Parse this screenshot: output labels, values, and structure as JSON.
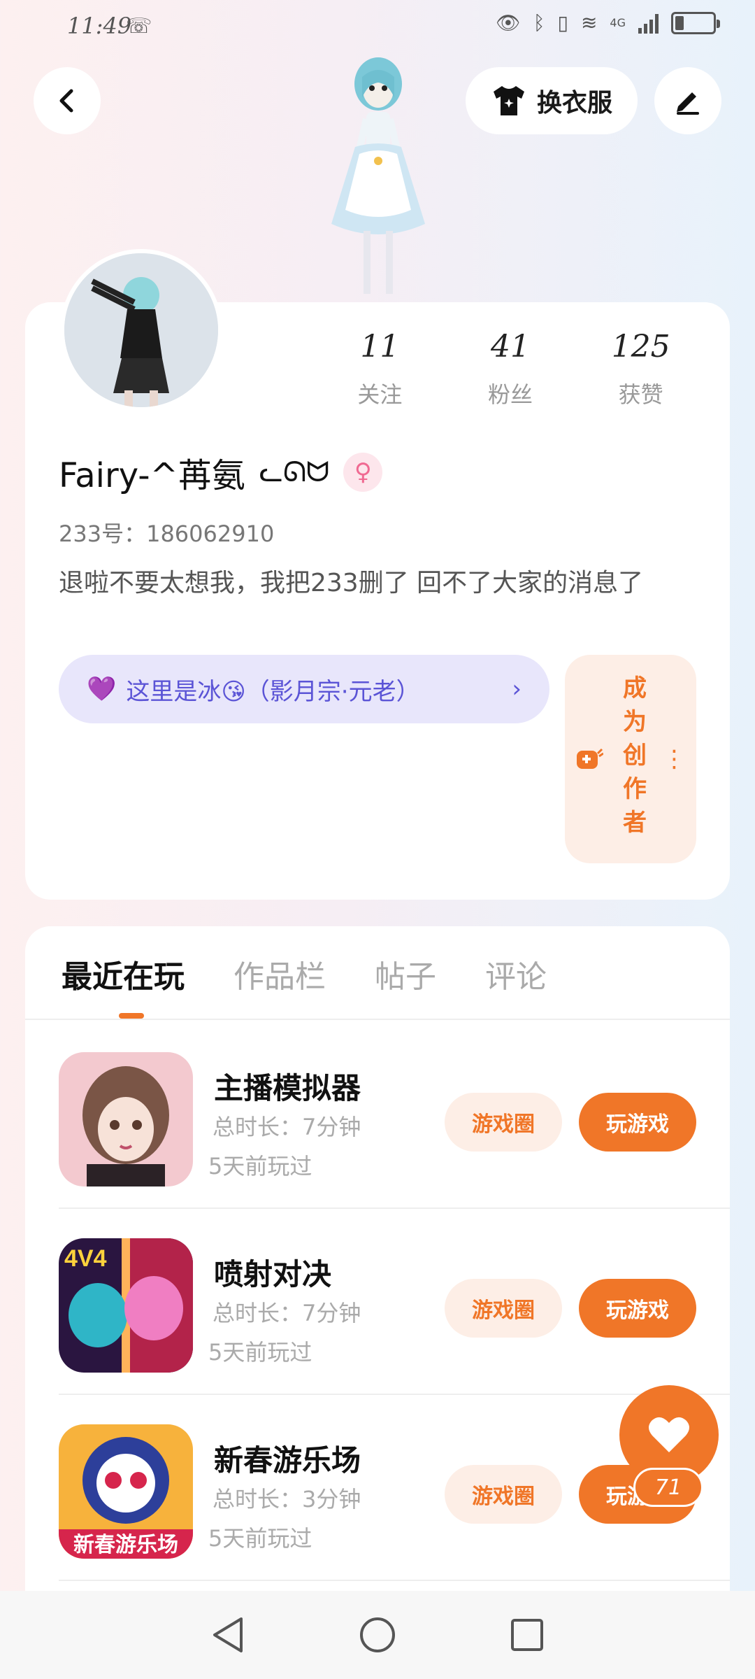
{
  "status_bar": {
    "time": "11:49",
    "network_label": "4G",
    "battery_level": 0.2
  },
  "header": {
    "outfit_label": "换衣服"
  },
  "profile": {
    "stats": [
      {
        "value": "11",
        "label": "关注"
      },
      {
        "value": "41",
        "label": "粉丝"
      },
      {
        "value": "125",
        "label": "获赞"
      }
    ],
    "nickname": "Fairy-^苒氨",
    "nickname_emoji": "ᓚᘏᗢ",
    "gender_symbol": "♀",
    "uid": "233号：186062910",
    "bio": "退啦不要太想我，我把233删了 回不了大家的消息了",
    "group_pill": {
      "heart": "💜",
      "text": "这里是冰😘（影月宗·元老）",
      "chevron": "›"
    },
    "creator_button": {
      "label": "成为创作者",
      "dots": "⋮"
    }
  },
  "tabs": [
    {
      "label": "最近在玩",
      "active": true
    },
    {
      "label": "作品栏",
      "active": false
    },
    {
      "label": "帖子",
      "active": false
    },
    {
      "label": "评论",
      "active": false
    }
  ],
  "games": [
    {
      "name": "主播模拟器",
      "duration": "总时长：7分钟",
      "last_played": "5天前玩过",
      "circle_label": "游戏圈",
      "play_label": "玩游戏"
    },
    {
      "name": "喷射对决",
      "duration": "总时长：7分钟",
      "last_played": "5天前玩过",
      "circle_label": "游戏圈",
      "play_label": "玩游戏"
    },
    {
      "name": "新春游乐场",
      "duration": "总时长：3分钟",
      "last_played": "5天前玩过",
      "circle_label": "游戏圈",
      "play_label": "玩游戏"
    }
  ],
  "game_icon_texts": {
    "jet_badge": "4V4",
    "spring_badge": "新春游乐场"
  },
  "fab": {
    "count": "71"
  },
  "colors": {
    "accent": "#f07628",
    "accent_light": "#fdeee6",
    "group_pill_bg": "#e8e6fb",
    "group_pill_text": "#5b54d6"
  }
}
